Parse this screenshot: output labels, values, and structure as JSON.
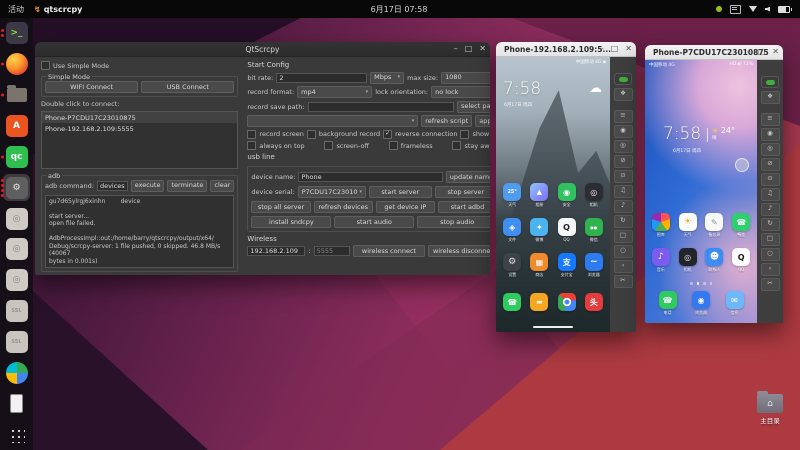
{
  "icons": {
    "minimize": "–",
    "maximize": "□",
    "close": "✕",
    "dropdown": "▾",
    "check": "✓",
    "cloud": "☁",
    "sun": "☀",
    "home_folder": "⌂",
    "app_indicator": "↯"
  },
  "topbar": {
    "activities": "活动",
    "app_name": "qtscrcpy",
    "clock": "6月17日 07:58"
  },
  "dock": {
    "items": [
      {
        "name": "terminal",
        "bg": "#3c3846",
        "glyph": ">_",
        "fg": "#8ae234",
        "dots": 2,
        "active": false,
        "type": "plain"
      },
      {
        "name": "firefox",
        "bg": "radial-gradient(circle at 35% 30%,#ffd24a,#ff9a2e 40%,#e5562a 72%,#b5320f)",
        "glyph": "",
        "fg": "#fff",
        "dots": 1,
        "active": false,
        "type": "round"
      },
      {
        "name": "files",
        "bg": "",
        "glyph": "",
        "fg": "",
        "dots": 1,
        "active": false,
        "type": "folder"
      },
      {
        "name": "ubuntu-software",
        "bg": "#e95420",
        "glyph": "A",
        "fg": "#fff",
        "dots": 0,
        "active": false,
        "type": "plain"
      },
      {
        "name": "qtscrcpy",
        "bg": "#2fbf4f",
        "glyph": "qc",
        "fg": "#fff",
        "dots": 1,
        "active": false,
        "type": "plain"
      },
      {
        "name": "settings",
        "bg": "#5f5f5f",
        "glyph": "⚙",
        "fg": "#e8e8e8",
        "dots": 4,
        "active": true,
        "type": "plain"
      },
      {
        "name": "app-generic-1",
        "bg": "#cfcac4",
        "glyph": "◎",
        "fg": "#8a867f",
        "dots": 0,
        "active": false,
        "type": "plain"
      },
      {
        "name": "app-generic-2",
        "bg": "#cfcac4",
        "glyph": "◎",
        "fg": "#8a867f",
        "dots": 0,
        "active": false,
        "type": "plain"
      },
      {
        "name": "app-generic-3",
        "bg": "#cfcac4",
        "glyph": "◎",
        "fg": "#8a867f",
        "dots": 0,
        "active": false,
        "type": "plain"
      },
      {
        "name": "app-ssl-1",
        "bg": "#c9c4be",
        "glyph": "SSL",
        "fg": "#97918a",
        "dots": 0,
        "active": false,
        "type": "tiny"
      },
      {
        "name": "app-ssl-2",
        "bg": "#c9c4be",
        "glyph": "SSL",
        "fg": "#97918a",
        "dots": 0,
        "active": false,
        "type": "tiny"
      },
      {
        "name": "pinwheel-app",
        "bg": "conic-gradient(from 0deg,#34a853 0 25%,#4285f4 0 50%,#fbbc05 0 75%,#00bcd4 0 100%)",
        "glyph": "",
        "fg": "",
        "dots": 0,
        "active": false,
        "type": "round"
      },
      {
        "name": "phone-app",
        "bg": "",
        "glyph": "",
        "fg": "",
        "dots": 0,
        "active": false,
        "type": "phone"
      },
      {
        "name": "show-apps",
        "bg": "",
        "glyph": "",
        "fg": "",
        "dots": 0,
        "active": false,
        "type": "grid"
      }
    ]
  },
  "desktop": {
    "home_label": "主目录"
  },
  "main_window": {
    "title": "QtScrcpy",
    "left": {
      "use_simple_mode": "Use Simple Mode",
      "simple_mode": "Simple Mode",
      "wifi_connect": "WIFI Connect",
      "usb_connect": "USB Connect",
      "double_click": "Double click to connect:",
      "devices": [
        "Phone-P7CDU17C23010875",
        "Phone-192.168.2.109:5555"
      ],
      "adb_group": "adb",
      "adb_command_label": "adb command:",
      "adb_command_value": "devices",
      "execute": "execute",
      "terminate": "terminate",
      "clear": "clear",
      "console_text": "gu7d65ylrgj6xinhn        device\n\nstart server...\nopen file failed.\n\nAdbProcessImpl::out:/home/barry/qtscrcpy/output/x64/\nDebug/scrcpy-server: 1 file pushed, 0 skipped. 46.8 MB/s (40067\nbytes in 0.001s)"
    },
    "right": {
      "start_config": "Start Config",
      "bit_rate_label": "bit rate:",
      "bit_rate_value": "2",
      "mbps": "Mbps",
      "max_size_label": "max size:",
      "max_size_value": "1080",
      "record_format_label": "record format:",
      "record_format_value": "mp4",
      "lock_orientation_label": "lock orientation:",
      "lock_orientation_value": "no lock",
      "record_save_path_label": "record save path:",
      "record_save_path_value": "",
      "select_path": "select path",
      "script_value": "",
      "refresh_script": "refresh script",
      "apply": "apply",
      "checkbox_rows": [
        [
          {
            "label": "record screen",
            "checked": false
          },
          {
            "label": "background record",
            "checked": false
          },
          {
            "label": "reverse connection",
            "checked": true
          },
          {
            "label": "show fps",
            "checked": false
          }
        ],
        [
          {
            "label": "always on top",
            "checked": false
          },
          {
            "label": "screen-off",
            "checked": false
          },
          {
            "label": "frameless",
            "checked": false
          },
          {
            "label": "stay awake",
            "checked": false
          }
        ]
      ],
      "usb_line": "usb line",
      "device_name_label": "device name:",
      "device_name_value": "Phone",
      "update_name": "update name",
      "device_serial_label": "device serial:",
      "device_serial_value": "P7CDU17C23010",
      "start_server": "start server",
      "stop_server": "stop server",
      "server_buttons": [
        "stop all server",
        "refresh devices",
        "get device IP",
        "start adbd"
      ],
      "audio_buttons": [
        "install sndcpy",
        "start audio",
        "stop audio"
      ],
      "wireless": "Wireless",
      "ip_value": "192.168.2.109",
      "port_separator": ":",
      "port_placeholder": "5555",
      "wireless_connect": "wireless connect",
      "wireless_disconnect": "wireless disconnect"
    }
  },
  "phone_toolbar": {
    "buttons": [
      {
        "name": "fullscreen-icon",
        "glyph": "❖"
      },
      {
        "name": "menu-icon",
        "glyph": "≡"
      },
      {
        "name": "screenshot-icon",
        "glyph": "◉"
      },
      {
        "name": "screen-on-icon",
        "glyph": "◎"
      },
      {
        "name": "screen-off-icon",
        "glyph": "⊘"
      },
      {
        "name": "power-icon",
        "glyph": "⊙"
      },
      {
        "name": "volume-up-icon",
        "glyph": "♫"
      },
      {
        "name": "volume-down-icon",
        "glyph": "♪"
      },
      {
        "name": "rotate-icon",
        "glyph": "↻"
      },
      {
        "name": "app-switch-icon",
        "glyph": "□"
      },
      {
        "name": "home-icon",
        "glyph": "○"
      },
      {
        "name": "back-icon",
        "glyph": "‹"
      },
      {
        "name": "screenshot-crop-icon",
        "glyph": "✂"
      }
    ]
  },
  "phone1": {
    "title": "Phone-192.168.2.109:5...",
    "status_right": "中国移动 4G ▪",
    "clock": "7:58",
    "date": "6月17日 周四",
    "weather_glyph": "☁",
    "grid": [
      {
        "label": "天气",
        "bg": "#4f9bf0",
        "glyph": "25°",
        "fg": "#fff",
        "gs": "5px"
      },
      {
        "label": "相册",
        "bg": "linear-gradient(135deg,#8ec5ff,#7d6bf2)",
        "glyph": "▲",
        "fg": "#fff",
        "gs": "7px"
      },
      {
        "label": "安全",
        "bg": "#31c161",
        "glyph": "◉",
        "fg": "#fff",
        "gs": "8px"
      },
      {
        "label": "相机",
        "bg": "#2b2d33",
        "glyph": "◎",
        "fg": "#eee",
        "gs": "8px"
      },
      {
        "label": "文件",
        "bg": "#3f8ef0",
        "glyph": "◈",
        "fg": "#fff",
        "gs": "8px"
      },
      {
        "label": "微博",
        "bg": "#4ab3f0",
        "glyph": "✦",
        "fg": "#fff",
        "gs": "8px"
      },
      {
        "label": "QQ",
        "bg": "#f5f6f8",
        "glyph": "Q",
        "fg": "#222",
        "gs": "8px"
      },
      {
        "label": "微信",
        "bg": "#2fb34f",
        "glyph": "●●",
        "fg": "#fff",
        "gs": "4px"
      },
      {
        "label": "设置",
        "bg": "#3d4148",
        "glyph": "⚙",
        "fg": "#dfe3e8",
        "gs": "9px"
      },
      {
        "label": "商店",
        "bg": "#f08a2e",
        "glyph": "▦",
        "fg": "#fff",
        "gs": "8px"
      },
      {
        "label": "支付宝",
        "bg": "#1677ff",
        "glyph": "支",
        "fg": "#fff",
        "gs": "8px"
      },
      {
        "label": "浏览器",
        "bg": "#2e7bf0",
        "glyph": "~",
        "fg": "#fff",
        "gs": "9px"
      }
    ],
    "dock": [
      {
        "label": "",
        "bg": "#2ecc5e",
        "glyph": "☎",
        "fg": "#fff",
        "gs": "8px"
      },
      {
        "label": "",
        "bg": "#f5a623",
        "glyph": "▬",
        "fg": "rgba(255,255,255,.85)",
        "gs": "7px"
      },
      {
        "label": "",
        "bg": "radial-gradient(circle,#4285f4 0 18%,#fff 19% 32%,transparent 33%),conic-gradient(from -45deg,#ea4335 0 120deg,#4285f4 0 240deg,#34a853 0 360deg)",
        "glyph": "",
        "fg": "#fff",
        "gs": "7px"
      },
      {
        "label": "",
        "bg": "#e23c3c",
        "glyph": "头",
        "fg": "#fff",
        "gs": "8px"
      }
    ]
  },
  "phone2": {
    "title": "Phone-P7CDU17C23010875",
    "status_left": "中国移动 4G",
    "status_right": "HD ◐ 72%",
    "clock": "7:58",
    "temp": "24°",
    "weather_small": "晴",
    "weather_glyph": "⛅",
    "date": "6月17日 周四",
    "grid": [
      {
        "label": "图库",
        "bg": "conic-gradient(from 0deg,#ff5252 0 20%,#ffb300 0 40%,#4caf50 0 60%,#2196f3 0 80%,#9c27b0 0 100%)",
        "glyph": "",
        "fg": "#fff",
        "gs": "7px"
      },
      {
        "label": "天气",
        "bg": "#fdfdfd",
        "glyph": "☀",
        "fg": "#f6a623",
        "gs": "9px"
      },
      {
        "label": "备忘录",
        "bg": "#f7f8fa",
        "glyph": "✎",
        "fg": "#8a8f98",
        "gs": "8px"
      },
      {
        "label": "畅连",
        "bg": "#2ed06e",
        "glyph": "☎",
        "fg": "#fff",
        "gs": "8px"
      },
      {
        "label": "音乐",
        "bg": "#7b5cf0",
        "glyph": "♪",
        "fg": "#fff",
        "gs": "9px"
      },
      {
        "label": "相机",
        "bg": "#23252b",
        "glyph": "◎",
        "fg": "#e8e8e8",
        "gs": "8px"
      },
      {
        "label": "联系人",
        "bg": "#3b8df5",
        "glyph": "☻",
        "fg": "#fff",
        "gs": "9px"
      },
      {
        "label": "QQ",
        "bg": "#fbfbfb",
        "glyph": "Q",
        "fg": "#1a1a1a",
        "gs": "8px"
      }
    ],
    "dock": [
      {
        "label": "电话",
        "bg": "#2ecc5e",
        "glyph": "☎",
        "fg": "#fff",
        "gs": "8px"
      },
      {
        "label": "浏览器",
        "bg": "#3579f0",
        "glyph": "◉",
        "fg": "#fff",
        "gs": "8px"
      },
      {
        "label": "信息",
        "bg": "#6cb8f8",
        "glyph": "✉",
        "fg": "#fff",
        "gs": "8px"
      }
    ]
  }
}
